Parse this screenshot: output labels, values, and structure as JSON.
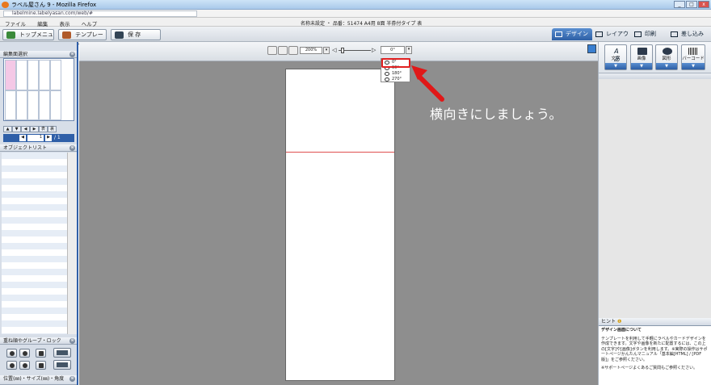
{
  "window": {
    "title": "ラベル屋さん 9 - Mozilla Firefox",
    "url": "labelmine.labelyasan.com/web/#"
  },
  "menubar": {
    "items": [
      "ファイル",
      "編集",
      "表示",
      "ヘルプ"
    ],
    "info": "名称未設定 ・ 品番：51474 A4用 8面 半券付タイプ 表"
  },
  "toolbar": {
    "top_menu": "トップメニュー",
    "template": "テンプレート",
    "save": "保 存",
    "zoom": "200%",
    "rotation": "0°",
    "tabs": [
      "デザイン",
      "レイアウト",
      "印刷",
      "差し込み"
    ]
  },
  "left": {
    "edit_select": "編集面選択",
    "page_current": "1",
    "page_total": "/ 1",
    "object_list": "オブジェクトリスト",
    "group_lock": "重ね順やグループ・ロック",
    "position_size": "位置(㎜)・サイズ(㎜)・角度"
  },
  "rotation_menu": {
    "options": [
      "0°",
      "90°",
      "180°",
      "270°"
    ]
  },
  "callout": "横向きにしましょう。",
  "right": {
    "buttons": [
      "文字",
      "画像",
      "図形",
      "バーコード"
    ],
    "hint_title": "ヒント",
    "hint_heading": "デザイン画面について",
    "hint_body": "テンプレートを利用して手軽にラベルやカードデザインを作成できます。文字や画像を新たに配置するには、この上の[文字]や[画像]ボタンを利用します。※実際の操作はサポートページかんたんマニュアル「基本編[HTML] / [PDF版]」をご参照ください。",
    "hint_support": "※サポートページよくあるご質問もご参照ください。"
  },
  "colors": {
    "accent": "#2f5fa8",
    "highlight": "#e02020",
    "page_fill": "#f4c8e6"
  }
}
